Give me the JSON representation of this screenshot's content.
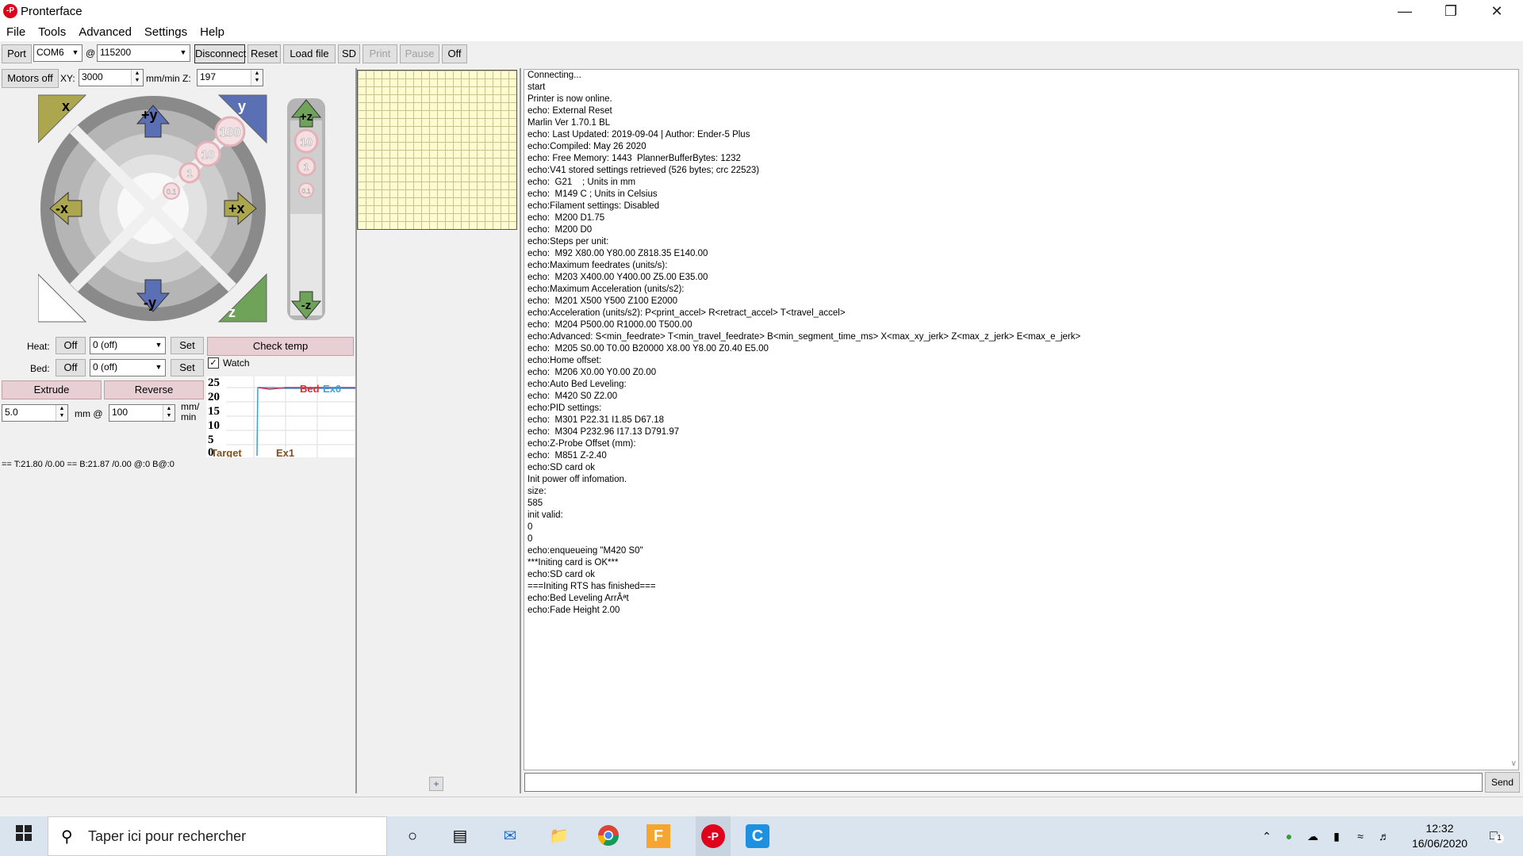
{
  "window": {
    "title": "Pronterface",
    "app_icon_label": "-P"
  },
  "menu": [
    "File",
    "Tools",
    "Advanced",
    "Settings",
    "Help"
  ],
  "toolbar": {
    "port_label": "Port",
    "port_value": "COM6",
    "at": "@",
    "baud_value": "115200",
    "disconnect": "Disconnect",
    "reset": "Reset",
    "load_file": "Load file",
    "sd": "SD",
    "print": "Print",
    "pause": "Pause",
    "off": "Off"
  },
  "motion": {
    "motors_off": "Motors off",
    "xy_label": "XY:",
    "xy_value": "3000",
    "unit_label": "mm/min Z:",
    "z_value": "197"
  },
  "jog": {
    "home_x": "x",
    "home_y": "y",
    "home_z": "z",
    "plus_y": "+y",
    "minus_y": "-y",
    "plus_x": "+x",
    "minus_x": "-x",
    "steps": [
      "100",
      "10",
      "1",
      "0.1"
    ],
    "z_plus": "+z",
    "z_minus": "-z",
    "z_steps": [
      "10",
      "1",
      "0.1"
    ]
  },
  "temps": {
    "heat_label": "Heat:",
    "heat_off": "Off",
    "heat_value": "0 (off)",
    "heat_set": "Set",
    "bed_label": "Bed:",
    "bed_off": "Off",
    "bed_value": "0 (off)",
    "bed_set": "Set",
    "check_temp": "Check temp",
    "watch_label": "Watch",
    "watch_check": "✓"
  },
  "extrude": {
    "extrude": "Extrude",
    "reverse": "Reverse",
    "length_value": "5.0",
    "mm_at": "mm @",
    "speed_value": "100",
    "unit": "mm/\nmin"
  },
  "graph": {
    "y_ticks": [
      "25",
      "20",
      "15",
      "10",
      "5",
      "0"
    ],
    "legend_bed": "Bed",
    "legend_ex0": "Ex0",
    "legend_target": "Target",
    "legend_ex1": "Ex1",
    "colors": {
      "bed": "#e03030",
      "ex0": "#3aa0e0"
    }
  },
  "status_text": "== T:21.80 /0.00 == B:21.87 /0.00 @:0 B@:0",
  "console": {
    "lines": [
      "Connecting...",
      "start",
      "Printer is now online.",
      "echo: External Reset",
      "Marlin Ver 1.70.1 BL",
      "echo: Last Updated: 2019-09-04 | Author: Ender-5 Plus",
      "echo:Compiled: May 26 2020",
      "echo: Free Memory: 1443  PlannerBufferBytes: 1232",
      "echo:V41 stored settings retrieved (526 bytes; crc 22523)",
      "echo:  G21    ; Units in mm",
      "echo:  M149 C ; Units in Celsius",
      "echo:Filament settings: Disabled",
      "echo:  M200 D1.75",
      "echo:  M200 D0",
      "echo:Steps per unit:",
      "echo:  M92 X80.00 Y80.00 Z818.35 E140.00",
      "echo:Maximum feedrates (units/s):",
      "echo:  M203 X400.00 Y400.00 Z5.00 E35.00",
      "echo:Maximum Acceleration (units/s2):",
      "echo:  M201 X500 Y500 Z100 E2000",
      "echo:Acceleration (units/s2): P<print_accel> R<retract_accel> T<travel_accel>",
      "echo:  M204 P500.00 R1000.00 T500.00",
      "echo:Advanced: S<min_feedrate> T<min_travel_feedrate> B<min_segment_time_ms> X<max_xy_jerk> Z<max_z_jerk> E<max_e_jerk>",
      "echo:  M205 S0.00 T0.00 B20000 X8.00 Y8.00 Z0.40 E5.00",
      "echo:Home offset:",
      "echo:  M206 X0.00 Y0.00 Z0.00",
      "echo:Auto Bed Leveling:",
      "echo:  M420 S0 Z2.00",
      "echo:PID settings:",
      "echo:  M301 P22.31 I1.85 D67.18",
      "echo:  M304 P232.96 I17.13 D791.97",
      "echo:Z-Probe Offset (mm):",
      "echo:  M851 Z-2.40",
      "echo:SD card ok",
      "Init power off infomation.",
      "size:",
      "585",
      "init valid:",
      "0",
      "0",
      "echo:enqueueing \"M420 S0\"",
      "***Initing card is OK***",
      "echo:SD card ok",
      "===Initing RTS has finished===",
      "echo:Bed Leveling ArrÂªt",
      "echo:Fade Height 2.00"
    ],
    "send": "Send",
    "plus": "+"
  },
  "taskbar": {
    "search_placeholder": "Taper ici pour rechercher",
    "time": "12:32",
    "date": "16/06/2020",
    "notif_count": "1",
    "icons": [
      "windows-icon",
      "search-icon",
      "cortana-icon",
      "task-view-icon",
      "mail-icon",
      "explorer-icon",
      "chrome-icon",
      "foxit-icon",
      "pronterface-icon",
      "ccleaner-icon"
    ]
  }
}
